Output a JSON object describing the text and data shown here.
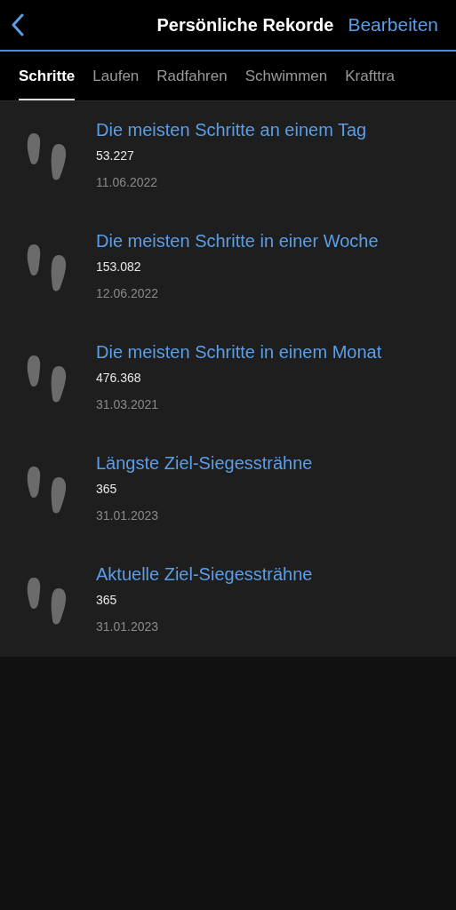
{
  "header": {
    "title": "Persönliche Rekorde",
    "action": "Bearbeiten"
  },
  "tabs": [
    {
      "label": "Schritte",
      "selected": true
    },
    {
      "label": "Laufen",
      "selected": false
    },
    {
      "label": "Radfahren",
      "selected": false
    },
    {
      "label": "Schwimmen",
      "selected": false
    },
    {
      "label": "Krafttra",
      "selected": false
    }
  ],
  "records": [
    {
      "title": "Die meisten Schritte an einem Tag",
      "value": "53.227",
      "date": "11.06.2022"
    },
    {
      "title": "Die meisten Schritte in einer Woche",
      "value": "153.082",
      "date": "12.06.2022"
    },
    {
      "title": "Die meisten Schritte in einem Monat",
      "value": "476.368",
      "date": "31.03.2021"
    },
    {
      "title": "Längste Ziel-Siegessträhne",
      "value": "365",
      "date": "31.01.2023"
    },
    {
      "title": "Aktuelle Ziel-Siegessträhne",
      "value": "365",
      "date": "31.01.2023"
    }
  ]
}
